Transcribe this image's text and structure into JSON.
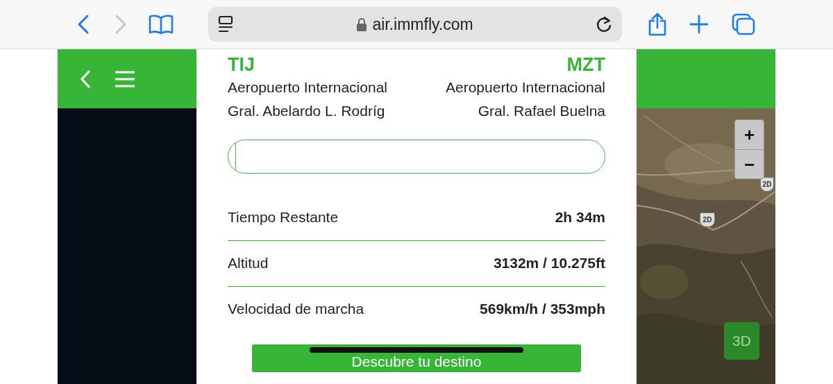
{
  "browser": {
    "url": "air.immfly.com"
  },
  "route": {
    "origin": {
      "code": "TIJ",
      "name_line_1": "Aeropuerto Internacional",
      "name_line_2": "Gral. Abelardo L. Rodríg"
    },
    "destination": {
      "code": "MZT",
      "name_line_1": "Aeropuerto Internacional",
      "name_line_2": "Gral. Rafael Buelna"
    }
  },
  "progress": {
    "level": 0.02
  },
  "stats": [
    {
      "label": "Tiempo Restante",
      "value": "2h 34m"
    },
    {
      "label": "Altitud",
      "value": "3132m / 10.275ft"
    },
    {
      "label": "Velocidad de marcha",
      "value": "569km/h / 353mph"
    }
  ],
  "map": {
    "zoom_in": "+",
    "zoom_out": "−",
    "shields": [
      "2D",
      "2D"
    ],
    "view_button": "3D"
  },
  "cta_button": "Descubre tu destino"
}
